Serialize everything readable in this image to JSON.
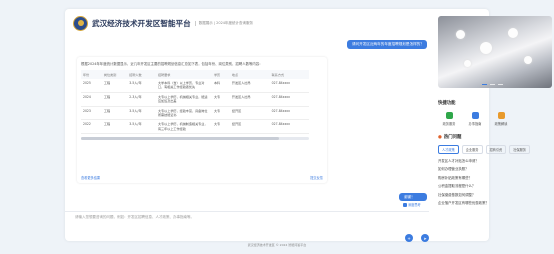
{
  "header": {
    "title": "武汉经济技术开发区智能平台",
    "tag": "数据展示 | 2024年度统计查询服务"
  },
  "chat": {
    "user_message_1": "请问开发区近两年的年度招聘规划是怎样的？",
    "answer_intro": "根据2024年年度统计数据显示，近几年开发区主要的招聘规划信息汇总如下表，包括年份、岗位类别、招聘人数等内容：",
    "table": {
      "headers": [
        "年份",
        "岗位类别",
        "招聘人数",
        "招聘要求",
        "学历",
        "地点",
        "联系方式"
      ],
      "rows": [
        [
          "2025",
          "工程",
          "3-5人/年",
          "大学本科（含）以上学历，专业对口，有相关工作经验者优先",
          "本科",
          "开发区人社局",
          "027-84xxxx"
        ],
        [
          "2024",
          "工程",
          "2-3人/年",
          "大专以上学历，机械相关专业，能适应加班及出差",
          "大专",
          "开发区人社局",
          "027-84xxxx"
        ],
        [
          "2023",
          "工程",
          "3-5人/年",
          "大专以上学历，经验丰富，具备岗位所需技能证书",
          "大专",
          "经开区",
          "027-84xxxx"
        ],
        [
          "2022",
          "工程",
          "3-5人/年",
          "大专以上学历，机械制造相关专业，有三年以上工作经验",
          "大专",
          "经开区",
          "027-84xxxx"
        ]
      ]
    },
    "link_left": "查看更多结果",
    "link_right": "提交反馈",
    "user_message_2": "谢谢！",
    "deep_think": "深度思考",
    "input_placeholder": "请输入您想要咨询的问题，例如：开发区招聘信息、人才政策、办事指南等。"
  },
  "sidebar": {
    "quick_title": "快捷功能",
    "quick_items": [
      {
        "label": "政务服务",
        "color": "#2fa74a"
      },
      {
        "label": "办事指南",
        "color": "#3c7ce0"
      },
      {
        "label": "政策解读",
        "color": "#e89a2c"
      }
    ],
    "hot_title": "热门问题",
    "tabs": [
      "人才政策",
      "企业服务",
      "招商引资",
      "社保服务"
    ],
    "questions": [
      "开发区人才补贴怎么申请？",
      "如何办理营业执照？",
      "购房补贴政策有哪些？",
      "公积金提取流程是什么？",
      "社保缴费基数如何调整？",
      "企业落户开发区有哪些优惠政策？"
    ]
  },
  "footer": "武汉经济技术开发区 © 2024 智能问答平台"
}
